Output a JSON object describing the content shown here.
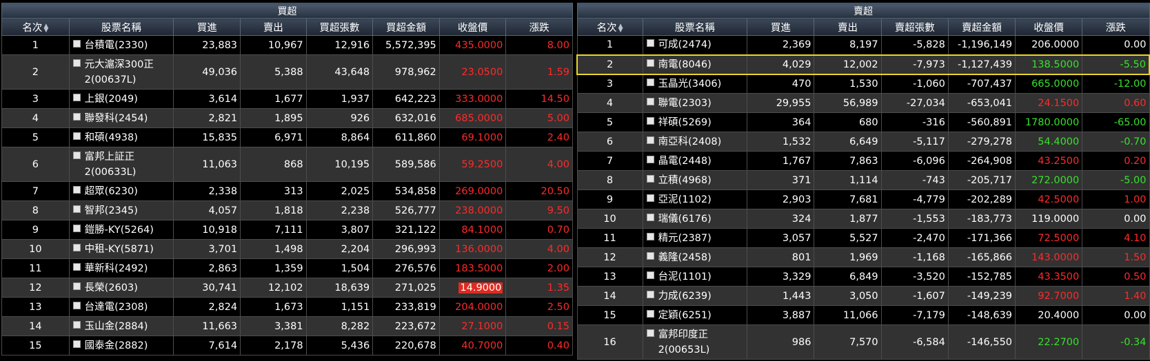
{
  "left": {
    "title": "買超",
    "columns": [
      "名次",
      "股票名稱",
      "買進",
      "賣出",
      "買超張數",
      "買超金額",
      "收盤價",
      "漲跌"
    ],
    "rows": [
      {
        "rank": "1",
        "name": "台積電(2330)",
        "buy": "23,883",
        "sell": "10,967",
        "net": "12,916",
        "amount": "5,572,395",
        "close": "435.0000",
        "change": "8.00",
        "dir": "up"
      },
      {
        "rank": "2",
        "name": "元大滬深300正2(00637L)",
        "buy": "49,036",
        "sell": "5,388",
        "net": "43,648",
        "amount": "978,962",
        "close": "23.0500",
        "change": "1.59",
        "dir": "up",
        "tall": true
      },
      {
        "rank": "3",
        "name": "上銀(2049)",
        "buy": "3,614",
        "sell": "1,677",
        "net": "1,937",
        "amount": "642,223",
        "close": "333.0000",
        "change": "14.50",
        "dir": "up"
      },
      {
        "rank": "4",
        "name": "聯發科(2454)",
        "buy": "2,821",
        "sell": "1,895",
        "net": "926",
        "amount": "632,016",
        "close": "685.0000",
        "change": "5.00",
        "dir": "up"
      },
      {
        "rank": "5",
        "name": "和碩(4938)",
        "buy": "15,835",
        "sell": "6,971",
        "net": "8,864",
        "amount": "611,860",
        "close": "69.1000",
        "change": "2.40",
        "dir": "up"
      },
      {
        "rank": "6",
        "name": "富邦上証正2(00633L)",
        "buy": "11,063",
        "sell": "868",
        "net": "10,195",
        "amount": "589,586",
        "close": "59.2500",
        "change": "4.00",
        "dir": "up",
        "tall": true
      },
      {
        "rank": "7",
        "name": "超眾(6230)",
        "buy": "2,338",
        "sell": "313",
        "net": "2,025",
        "amount": "534,858",
        "close": "269.0000",
        "change": "20.50",
        "dir": "up"
      },
      {
        "rank": "8",
        "name": "智邦(2345)",
        "buy": "4,057",
        "sell": "1,818",
        "net": "2,238",
        "amount": "526,777",
        "close": "238.0000",
        "change": "9.50",
        "dir": "up"
      },
      {
        "rank": "9",
        "name": "鎧勝-KY(5264)",
        "buy": "10,918",
        "sell": "7,111",
        "net": "3,807",
        "amount": "321,122",
        "close": "84.1000",
        "change": "0.70",
        "dir": "up"
      },
      {
        "rank": "10",
        "name": "中租-KY(5871)",
        "buy": "3,701",
        "sell": "1,498",
        "net": "2,204",
        "amount": "296,993",
        "close": "136.0000",
        "change": "4.00",
        "dir": "up"
      },
      {
        "rank": "11",
        "name": "華新科(2492)",
        "buy": "2,863",
        "sell": "1,359",
        "net": "1,504",
        "amount": "276,576",
        "close": "183.5000",
        "change": "2.00",
        "dir": "up"
      },
      {
        "rank": "12",
        "name": "長榮(2603)",
        "buy": "30,741",
        "sell": "12,102",
        "net": "18,639",
        "amount": "271,025",
        "close": "14.9000",
        "change": "1.35",
        "dir": "up",
        "limit": true
      },
      {
        "rank": "13",
        "name": "台達電(2308)",
        "buy": "2,824",
        "sell": "1,673",
        "net": "1,151",
        "amount": "233,819",
        "close": "204.0000",
        "change": "2.50",
        "dir": "up"
      },
      {
        "rank": "14",
        "name": "玉山金(2884)",
        "buy": "11,663",
        "sell": "3,381",
        "net": "8,282",
        "amount": "223,672",
        "close": "27.1000",
        "change": "0.15",
        "dir": "up"
      },
      {
        "rank": "15",
        "name": "國泰金(2882)",
        "buy": "7,614",
        "sell": "2,178",
        "net": "5,436",
        "amount": "220,678",
        "close": "40.7000",
        "change": "0.40",
        "dir": "up"
      }
    ]
  },
  "right": {
    "title": "賣超",
    "columns": [
      "名次",
      "股票名稱",
      "買進",
      "賣出",
      "賣超張數",
      "賣超金額",
      "收盤價",
      "漲跌"
    ],
    "rows": [
      {
        "rank": "1",
        "name": "可成(2474)",
        "buy": "2,369",
        "sell": "8,197",
        "net": "-5,828",
        "amount": "-1,196,149",
        "close": "206.0000",
        "change": "0.00",
        "dir": "flat"
      },
      {
        "rank": "2",
        "name": "南電(8046)",
        "buy": "4,029",
        "sell": "12,002",
        "net": "-7,973",
        "amount": "-1,127,439",
        "close": "138.5000",
        "change": "-5.50",
        "dir": "down",
        "selected": true
      },
      {
        "rank": "3",
        "name": "玉晶光(3406)",
        "buy": "470",
        "sell": "1,530",
        "net": "-1,060",
        "amount": "-707,437",
        "close": "665.0000",
        "change": "-12.00",
        "dir": "down"
      },
      {
        "rank": "4",
        "name": "聯電(2303)",
        "buy": "29,955",
        "sell": "56,989",
        "net": "-27,034",
        "amount": "-653,041",
        "close": "24.1500",
        "change": "0.60",
        "dir": "up"
      },
      {
        "rank": "5",
        "name": "祥碩(5269)",
        "buy": "364",
        "sell": "680",
        "net": "-316",
        "amount": "-560,891",
        "close": "1780.0000",
        "change": "-65.00",
        "dir": "down"
      },
      {
        "rank": "6",
        "name": "南亞科(2408)",
        "buy": "1,532",
        "sell": "6,649",
        "net": "-5,117",
        "amount": "-279,278",
        "close": "54.4000",
        "change": "-0.70",
        "dir": "down"
      },
      {
        "rank": "7",
        "name": "晶電(2448)",
        "buy": "1,767",
        "sell": "7,863",
        "net": "-6,096",
        "amount": "-264,908",
        "close": "43.2500",
        "change": "0.20",
        "dir": "up"
      },
      {
        "rank": "8",
        "name": "立積(4968)",
        "buy": "371",
        "sell": "1,114",
        "net": "-743",
        "amount": "-205,717",
        "close": "272.0000",
        "change": "-5.00",
        "dir": "down"
      },
      {
        "rank": "9",
        "name": "亞泥(1102)",
        "buy": "2,903",
        "sell": "7,681",
        "net": "-4,779",
        "amount": "-202,289",
        "close": "42.5000",
        "change": "1.00",
        "dir": "up"
      },
      {
        "rank": "10",
        "name": "瑞儀(6176)",
        "buy": "324",
        "sell": "1,877",
        "net": "-1,553",
        "amount": "-183,773",
        "close": "119.0000",
        "change": "0.00",
        "dir": "flat"
      },
      {
        "rank": "11",
        "name": "精元(2387)",
        "buy": "3,057",
        "sell": "5,527",
        "net": "-2,470",
        "amount": "-171,366",
        "close": "72.5000",
        "change": "4.10",
        "dir": "up"
      },
      {
        "rank": "12",
        "name": "義隆(2458)",
        "buy": "801",
        "sell": "1,969",
        "net": "-1,168",
        "amount": "-165,866",
        "close": "143.0000",
        "change": "1.50",
        "dir": "up"
      },
      {
        "rank": "13",
        "name": "台泥(1101)",
        "buy": "3,329",
        "sell": "6,849",
        "net": "-3,520",
        "amount": "-152,785",
        "close": "43.3500",
        "change": "0.50",
        "dir": "up"
      },
      {
        "rank": "14",
        "name": "力成(6239)",
        "buy": "1,443",
        "sell": "3,050",
        "net": "-1,607",
        "amount": "-149,239",
        "close": "92.7000",
        "change": "1.40",
        "dir": "up"
      },
      {
        "rank": "15",
        "name": "定穎(6251)",
        "buy": "3,887",
        "sell": "11,066",
        "net": "-7,179",
        "amount": "-148,639",
        "close": "20.4000",
        "change": "0.00",
        "dir": "flat"
      },
      {
        "rank": "16",
        "name": "富邦印度正2(00653L)",
        "buy": "986",
        "sell": "7,570",
        "net": "-6,584",
        "amount": "-146,550",
        "close": "22.2700",
        "change": "-0.34",
        "dir": "down",
        "tall": true
      }
    ]
  },
  "icons": {
    "sort": "sort-updown-icon",
    "checkbox": "checkbox-icon"
  },
  "colors": {
    "up": "#ff2a2a",
    "down": "#37e22b",
    "flat": "#ffffff",
    "selection": "#e8d62a",
    "limit_up_bg": "#e02a1f"
  }
}
